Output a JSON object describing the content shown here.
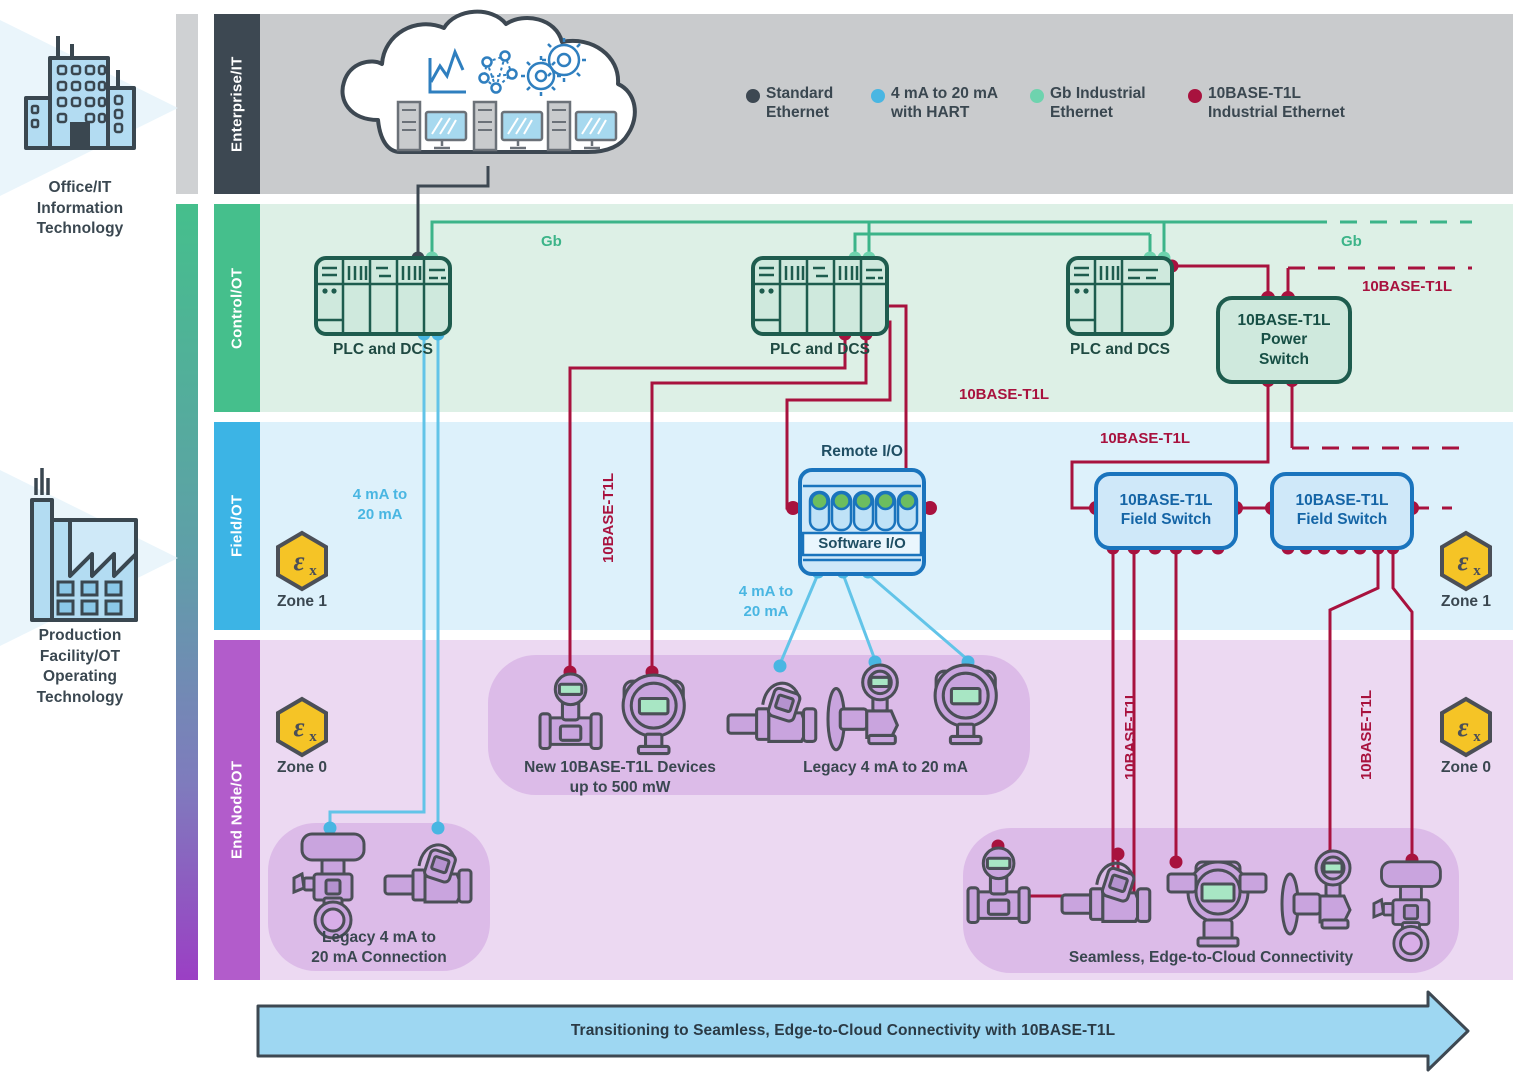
{
  "diagram": {
    "title": "Transitioning to Seamless, Edge-to-Cloud Connectivity with 10BASE-T1L"
  },
  "sidebar": {
    "items": [
      {
        "name": "office-it",
        "label": "Office/IT\nInformation\nTechnology",
        "line1": "Office/IT",
        "line2": "Information",
        "line3": "Technology"
      },
      {
        "name": "production-ot",
        "label": "Production Facility/OT Operating Technology",
        "line1": "Production",
        "line2": "Facility/OT",
        "line3": "Operating",
        "line4": "Technology"
      }
    ]
  },
  "bands": [
    {
      "name": "enterprise-it",
      "title": "Enterprise/IT",
      "tab_color": "#3d4852",
      "bg_color": "#c9cbcd"
    },
    {
      "name": "control-ot",
      "title": "Control/OT",
      "tab_color": "#45bf8c",
      "bg_color": "#ddf0e6"
    },
    {
      "name": "field-ot",
      "title": "Field/OT",
      "tab_color": "#3cb4e5",
      "bg_color": "#ddf1fb"
    },
    {
      "name": "end-node-ot",
      "title": "End Node/OT",
      "tab_color": "#b25ccb",
      "bg_color": "#ecd9f2"
    }
  ],
  "legend": {
    "items": [
      {
        "name": "standard-ethernet",
        "label": "Standard Ethernet",
        "line1": "Standard",
        "line2": "Ethernet",
        "color": "#3d4852"
      },
      {
        "name": "4-20ma-hart",
        "label": "4 mA to 20 mA with HART",
        "line1": "4 mA to 20 mA",
        "line2": "with HART",
        "color": "#49b6e2"
      },
      {
        "name": "gb-industrial-ethernet",
        "label": "Gb Industrial Ethernet",
        "line1": "Gb Industrial",
        "line2": "Ethernet",
        "color": "#6ed3ae"
      },
      {
        "name": "10base-t1l-industrial-ethernet",
        "label": "10BASE-T1L Industrial Ethernet",
        "line1": "10BASE-T1L",
        "line2": "Industrial Ethernet",
        "color": "#a8123e"
      }
    ]
  },
  "controllers": [
    {
      "name": "plc-dcs-1",
      "label": "PLC and DCS"
    },
    {
      "name": "plc-dcs-2",
      "label": "PLC and DCS"
    },
    {
      "name": "plc-dcs-3",
      "label": "PLC and DCS"
    }
  ],
  "nodes": {
    "power_switch": {
      "line1": "10BASE-T1L",
      "line2": "Power",
      "line3": "Switch",
      "label": "10BASE-T1L Power Switch"
    },
    "remote_io": {
      "title": "Remote I/O",
      "software_io": "Software I/O"
    },
    "field_switch_1": {
      "line1": "10BASE-T1L",
      "line2": "Field Switch",
      "label": "10BASE-T1L Field Switch"
    },
    "field_switch_2": {
      "line1": "10BASE-T1L",
      "line2": "Field Switch",
      "label": "10BASE-T1L Field Switch"
    }
  },
  "wire_labels": {
    "gb_left": "Gb",
    "gb_right": "Gb",
    "t1l_right_top": "10BASE-T1L",
    "t1l_control": "10BASE-T1L",
    "t1l_field": "10BASE-T1L",
    "t1l_vert_mid": "10BASE-T1L",
    "t1l_vert_right_a": "10BASE-T1L",
    "t1l_vert_right_b": "10BASE-T1L",
    "ma_left_line1": "4 mA to",
    "ma_left_line2": "20 mA",
    "ma_mid_line1": "4 mA to",
    "ma_mid_line2": "20 mA"
  },
  "zones": [
    {
      "name": "zone-1-left",
      "label": "Zone 1",
      "badge": "Ex"
    },
    {
      "name": "zone-0-left",
      "label": "Zone 0",
      "badge": "Ex"
    },
    {
      "name": "zone-1-right",
      "label": "Zone 1",
      "badge": "Ex"
    },
    {
      "name": "zone-0-right",
      "label": "Zone 0",
      "badge": "Ex"
    }
  ],
  "device_groups": [
    {
      "name": "new-t1l-devices",
      "line1": "New 10BASE-T1L Devices",
      "line2": "up to 500 mW",
      "label": "New 10BASE-T1L Devices up to 500 mW"
    },
    {
      "name": "legacy-4-20ma",
      "line1": "Legacy 4 mA to 20 mA",
      "label": "Legacy 4 mA to 20 mA"
    },
    {
      "name": "legacy-connection",
      "line1": "Legacy 4 mA to",
      "line2": "20 mA Connection",
      "label": "Legacy 4 mA to 20 mA Connection"
    },
    {
      "name": "seamless-connectivity",
      "line1": "Seamless, Edge-to-Cloud Connectivity",
      "label": "Seamless, Edge-to-Cloud Connectivity"
    }
  ],
  "colors": {
    "red": "#a8123e",
    "blue": "#49b6e2",
    "green": "#3cb489",
    "dark": "#3d4852",
    "banner_fill": "#9ed7f2",
    "ex_yellow": "#f5c426"
  }
}
